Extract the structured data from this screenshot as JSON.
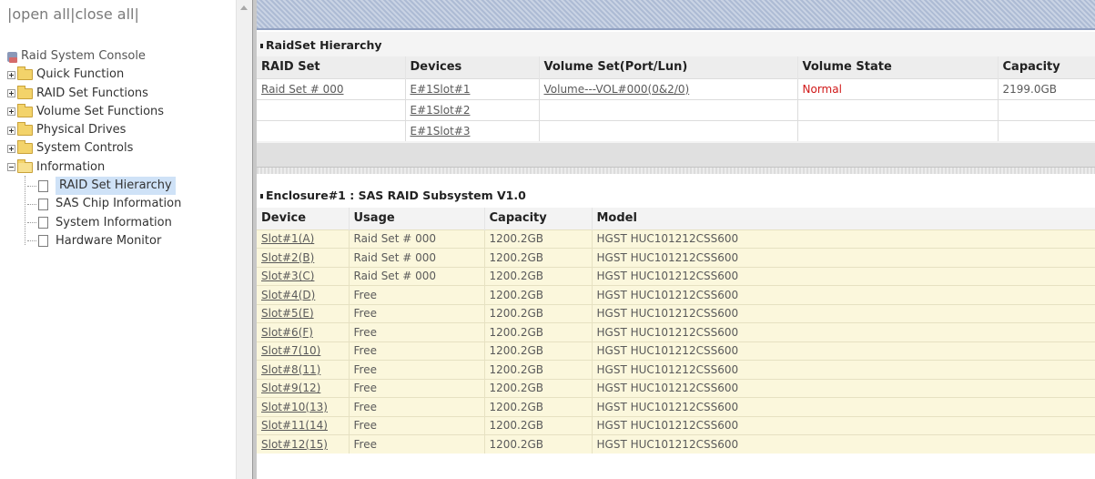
{
  "nav": {
    "links": {
      "open_all": "open all",
      "close_all": "close all"
    },
    "console_label": "Raid System Console",
    "folders": [
      {
        "label": "Quick Function",
        "expanded": false
      },
      {
        "label": "RAID Set Functions",
        "expanded": false
      },
      {
        "label": "Volume Set Functions",
        "expanded": false
      },
      {
        "label": "Physical Drives",
        "expanded": false
      },
      {
        "label": "System Controls",
        "expanded": false
      },
      {
        "label": "Information",
        "expanded": true
      }
    ],
    "info_items": [
      {
        "label": "RAID Set Hierarchy",
        "selected": true
      },
      {
        "label": "SAS Chip Information",
        "selected": false
      },
      {
        "label": "System Information",
        "selected": false
      },
      {
        "label": "Hardware Monitor",
        "selected": false
      }
    ]
  },
  "raidset": {
    "title": "RaidSet Hierarchy",
    "headers": [
      "RAID Set",
      "Devices",
      "Volume Set(Port/Lun)",
      "Volume State",
      "Capacity"
    ],
    "rows": [
      [
        "Raid Set # 000",
        "E#1Slot#1",
        "Volume---VOL#000(0&2/0)",
        "Normal",
        "2199.0GB"
      ],
      [
        "",
        "E#1Slot#2",
        "",
        "",
        ""
      ],
      [
        "",
        "E#1Slot#3",
        "",
        "",
        ""
      ]
    ]
  },
  "enclosure": {
    "title": "Enclosure#1 : SAS RAID Subsystem V1.0",
    "headers": [
      "Device",
      "Usage",
      "Capacity",
      "Model"
    ],
    "rows": [
      [
        "Slot#1(A)",
        "Raid Set # 000",
        "1200.2GB",
        "HGST HUC101212CSS600"
      ],
      [
        "Slot#2(B)",
        "Raid Set # 000",
        "1200.2GB",
        "HGST HUC101212CSS600"
      ],
      [
        "Slot#3(C)",
        "Raid Set # 000",
        "1200.2GB",
        "HGST HUC101212CSS600"
      ],
      [
        "Slot#4(D)",
        "Free",
        "1200.2GB",
        "HGST HUC101212CSS600"
      ],
      [
        "Slot#5(E)",
        "Free",
        "1200.2GB",
        "HGST HUC101212CSS600"
      ],
      [
        "Slot#6(F)",
        "Free",
        "1200.2GB",
        "HGST HUC101212CSS600"
      ],
      [
        "Slot#7(10)",
        "Free",
        "1200.2GB",
        "HGST HUC101212CSS600"
      ],
      [
        "Slot#8(11)",
        "Free",
        "1200.2GB",
        "HGST HUC101212CSS600"
      ],
      [
        "Slot#9(12)",
        "Free",
        "1200.2GB",
        "HGST HUC101212CSS600"
      ],
      [
        "Slot#10(13)",
        "Free",
        "1200.2GB",
        "HGST HUC101212CSS600"
      ],
      [
        "Slot#11(14)",
        "Free",
        "1200.2GB",
        "HGST HUC101212CSS600"
      ],
      [
        "Slot#12(15)",
        "Free",
        "1200.2GB",
        "HGST HUC101212CSS600"
      ]
    ]
  },
  "colors": {
    "accent_band": "#b9c6dc",
    "state_normal": "#d01818",
    "enclosure_row_bg": "#fbf7dc"
  }
}
